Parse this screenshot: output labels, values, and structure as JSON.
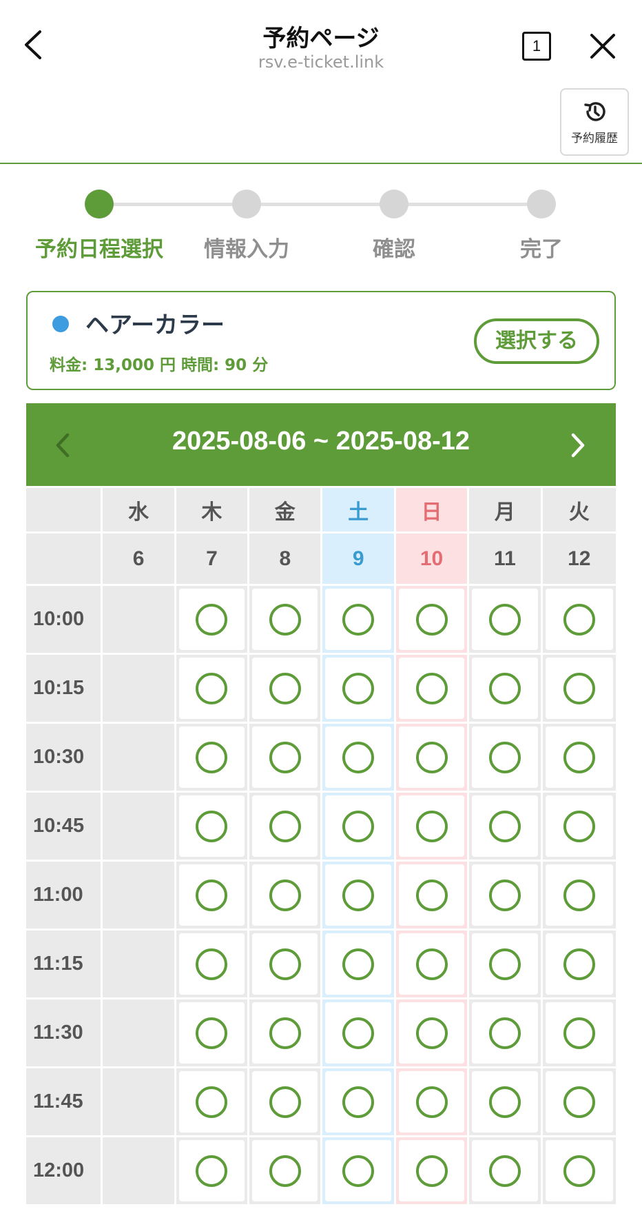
{
  "header": {
    "title": "予約ページ",
    "url": "rsv.e-ticket.link",
    "tab_count": "1",
    "history_label": "予約履歴"
  },
  "steps": [
    "予約日程選択",
    "情報入力",
    "確認",
    "完了"
  ],
  "menu": {
    "name": "ヘアーカラー",
    "meta": "料金: 13,000 円  時間: 90 分",
    "select_label": "選択する",
    "dot_color": "#3d9be0"
  },
  "calendar": {
    "range": "2025-08-06 ~ 2025-08-12",
    "days": [
      {
        "dow": "水",
        "date": "6",
        "type": "weekday",
        "available": false
      },
      {
        "dow": "木",
        "date": "7",
        "type": "weekday",
        "available": true
      },
      {
        "dow": "金",
        "date": "8",
        "type": "weekday",
        "available": true
      },
      {
        "dow": "土",
        "date": "9",
        "type": "sat",
        "available": true
      },
      {
        "dow": "日",
        "date": "10",
        "type": "sun",
        "available": true
      },
      {
        "dow": "月",
        "date": "11",
        "type": "weekday",
        "available": true
      },
      {
        "dow": "火",
        "date": "12",
        "type": "weekday",
        "available": true
      }
    ],
    "times": [
      "10:00",
      "10:15",
      "10:30",
      "10:45",
      "11:00",
      "11:15",
      "11:30",
      "11:45",
      "12:00"
    ]
  },
  "colors": {
    "accent": "#5e9b39",
    "saturday": "#3a9bd0",
    "sunday": "#e36d72"
  }
}
